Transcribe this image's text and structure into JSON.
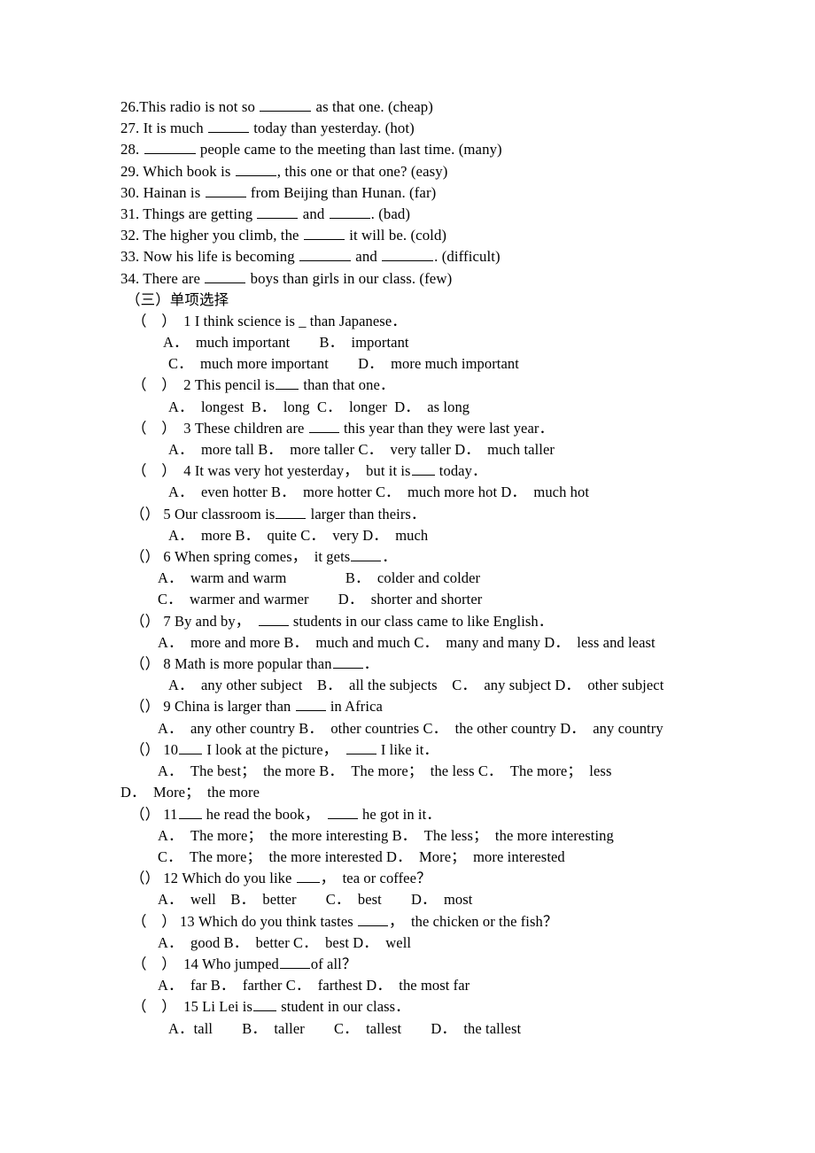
{
  "document": {
    "type": "english-grammar-worksheet",
    "language": "en-zh",
    "background_color": "#ffffff",
    "text_color": "#000000"
  },
  "fill_in_blanks": {
    "items": [
      {
        "number": "26.",
        "pre": "This radio is not so ",
        "blank": "b-xl",
        "post": " as that one. (cheap)"
      },
      {
        "number": "27. ",
        "pre": "It is much ",
        "blank": "b-l",
        "post": " today than yesterday. (hot)"
      },
      {
        "number": "28. ",
        "pre": "",
        "blank": "b-xl",
        "post": " people came to the meeting than last time. (many)"
      },
      {
        "number": "29. ",
        "pre": "Which book is ",
        "blank": "b-l",
        "post": ", this one or that one? (easy)"
      },
      {
        "number": "30. ",
        "pre": "Hainan is ",
        "blank": "b-l",
        "post": " from Beijing than Hunan. (far)"
      },
      {
        "number": "31. ",
        "pre": "Things are getting ",
        "blank": "b-l",
        "mid": " and ",
        "blank2": "b-l",
        "post": ". (bad)"
      },
      {
        "number": "32. ",
        "pre": "The higher you climb, the ",
        "blank": "b-l",
        "post": " it will be. (cold)"
      },
      {
        "number": "33. ",
        "pre": "Now his life is becoming ",
        "blank": "b-xl",
        "mid": " and ",
        "blank2": "b-xl",
        "post": ". (difficult)"
      },
      {
        "number": "34. ",
        "pre": "There are ",
        "blank": "b-l",
        "post": " boys than girls in our class. (few)"
      }
    ]
  },
  "section": {
    "heading": "（三）单项选择"
  },
  "multiple_choice": {
    "items": [
      {
        "marker": "（　）",
        "stem_pre": "  1 I think science is _ than Japanese．",
        "option_rows": [
          "A．　much important　　B．　important",
          "C．　much more important　　D．　more much important"
        ]
      },
      {
        "marker": "（　）",
        "stem_pre": "  2 This pencil is",
        "blank": "b-s",
        "stem_post": " than that one．",
        "option_rows": [
          "A．　longest  B．　long  C．　longer  D．　as long"
        ]
      },
      {
        "marker": "（　）",
        "stem_pre": "  3 These children are ",
        "blank": "b-m",
        "stem_post": " this year than they were last year．",
        "option_rows": [
          "A．　more tall B．　more taller C．　very taller D．　much taller"
        ]
      },
      {
        "marker": "（　）",
        "stem_pre": "  4 It was very hot yesterday，　but it is",
        "blank": "b-s",
        "stem_post": " today．",
        "option_rows": [
          "A．　even hotter B．　more hotter C．　much more hot D．　much hot"
        ]
      },
      {
        "marker": "（）",
        "stem_pre": " 5 Our classroom is",
        "blank": "b-m",
        "stem_post": " larger than theirs．",
        "option_rows": [
          "A．　more B．　quite C．　very D．　much"
        ]
      },
      {
        "marker": "（）",
        "stem_pre": " 6 When spring comes，　it gets",
        "blank": "b-m",
        "stem_post": "．",
        "option_rows": [
          "A．　warm and warm　　　　B．　colder and colder",
          "C．　warmer and warmer　　D．　shorter and shorter"
        ]
      },
      {
        "marker": "（）",
        "stem_pre": " 7 By and by，　",
        "blank": "b-m",
        "stem_post": " students in our class came to like English．",
        "option_rows": [
          "A．　more and more B．　much and much C．　many and many D．　less and least"
        ]
      },
      {
        "marker": "（）",
        "stem_pre": " 8 Math is more popular than",
        "blank": "b-m",
        "stem_post": "．",
        "option_rows": [
          "A．　any other subject　B．　all the subjects　C．　any subject D．　other subject"
        ]
      },
      {
        "marker": "（）",
        "stem_pre": " 9 China is larger than ",
        "blank": "b-m",
        "stem_post": " in Africa",
        "option_rows": [
          "A．　any other country B．　other countries C．　the other country D．　any country"
        ]
      },
      {
        "marker": "（）",
        "stem_pre": " 10",
        "blank": "b-s",
        "stem_post": " I look at the picture，　",
        "blank2": "b-m",
        "stem_post2": " I like it．",
        "option_rows": [
          "A．　The best；　the more B．　The more；　the less C．　The more；　less"
        ],
        "wrapped_row": "D．　More；　the more"
      },
      {
        "marker": "（）",
        "stem_pre": " 11",
        "blank": "b-s",
        "stem_post": " he read the book，　",
        "blank2": "b-m",
        "stem_post2": " he got in it．",
        "option_rows": [
          "A．　The more；　the more interesting B．　The less；　the more interesting",
          "C．　The more；　the more interested D．　More；　more interested"
        ]
      },
      {
        "marker": "（）",
        "stem_pre": " 12 Which do you like ",
        "blank": "b-s",
        "stem_post": "，　tea or coffee？",
        "option_rows": [
          "A．　well　B．　better　　C．　best　　D．　most"
        ]
      },
      {
        "marker": "（　）",
        "stem_pre": " 13 Which do you think tastes ",
        "blank": "b-m",
        "stem_post": "，　the chicken or the fish？",
        "option_rows": [
          "A．　good B．　better C．　best D．　well"
        ]
      },
      {
        "marker": "（　）",
        "stem_pre": "  14 Who jumped",
        "blank": "b-m",
        "stem_post": "of all？",
        "option_rows": [
          "A．　far B．　farther C．　farthest D．　the most far"
        ]
      },
      {
        "marker": "（　）",
        "stem_pre": "  15 Li Lei is",
        "blank": "b-s",
        "stem_post": " student in our class．",
        "option_rows": [
          "A．tall　　B．　taller　　C．　tallest　　D．　the tallest"
        ]
      }
    ]
  }
}
